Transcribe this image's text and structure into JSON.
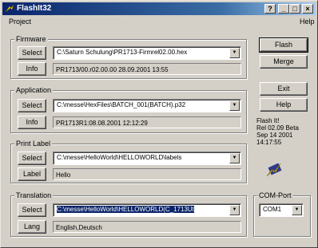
{
  "window": {
    "title": "FlashIt32"
  },
  "titlebar_buttons": [
    "?",
    "_",
    "□",
    "×"
  ],
  "menu": {
    "project": "Project",
    "help": "Help"
  },
  "firmware": {
    "label": "Firmware",
    "select_label": "Select",
    "info_label": "Info",
    "path": "C:\\Saturn Schulung\\PR1713-Firmrel02.00.hex",
    "info": "PR1713/00.r02.00.00 28.09.2001 13:55"
  },
  "application": {
    "label": "Application",
    "select_label": "Select",
    "info_label": "Info",
    "path": "C:\\messe\\HexFiles\\BATCH_001(BATCH).p32",
    "info": "PR1713R1:08.08.2001 12:12:29"
  },
  "print_label": {
    "label": "Print Label",
    "select_label": "Select",
    "label_button": "Label",
    "path": "C:\\messe\\HelloWorld\\HELLOWORLD\\labels",
    "info": "Hello"
  },
  "translation": {
    "label": "Translation",
    "select_label": "Select",
    "lang_label": "Lang",
    "path": "C:\\messe\\HelloWorld\\HELLOWORLD(C_1713Ut",
    "info": "English,Deutsch"
  },
  "side_buttons": {
    "flash": "Flash",
    "merge": "Merge",
    "exit": "Exit",
    "help": "Help"
  },
  "about": {
    "line1": "Flash It!",
    "line2": "Rel 02.09 Beta",
    "line3": "Sep 14 2001",
    "line4": "14:17:55"
  },
  "com_port": {
    "label": "COM-Port",
    "value": "COM1"
  }
}
